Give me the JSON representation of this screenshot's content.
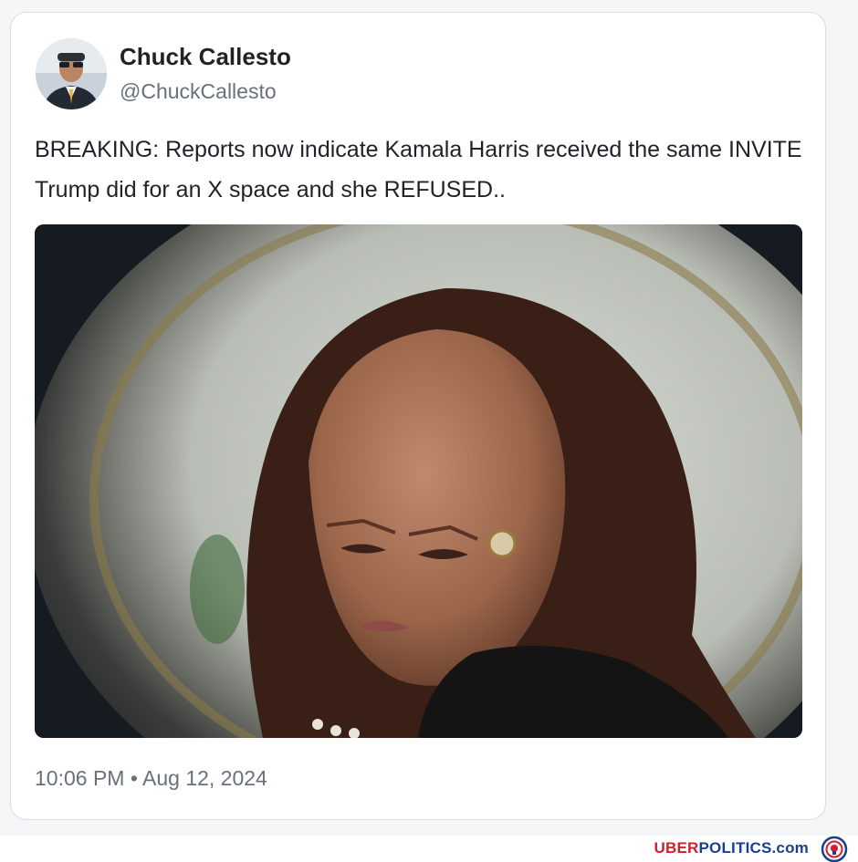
{
  "tweet": {
    "display_name": "Chuck Callesto",
    "handle": "@ChuckCallesto",
    "text": "BREAKING: Reports now indicate Kamala Harris received the same INVITE Trump did for an X space and she REFUSED..",
    "timestamp": "10:06 PM • Aug 12, 2024",
    "avatar_icon": "user-avatar-photo",
    "media_icon": "news-photo-portrait"
  },
  "watermark": {
    "brand_part1": "UBER",
    "brand_part2": "POLITICS.com",
    "brand_color_red": "#d21f2b",
    "brand_color_blue": "#1b3f8f",
    "logo_icon": "lion-crest-icon"
  },
  "colors": {
    "text_primary": "#1f2328",
    "text_secondary": "#68717b",
    "card_border": "#d9dee3"
  }
}
